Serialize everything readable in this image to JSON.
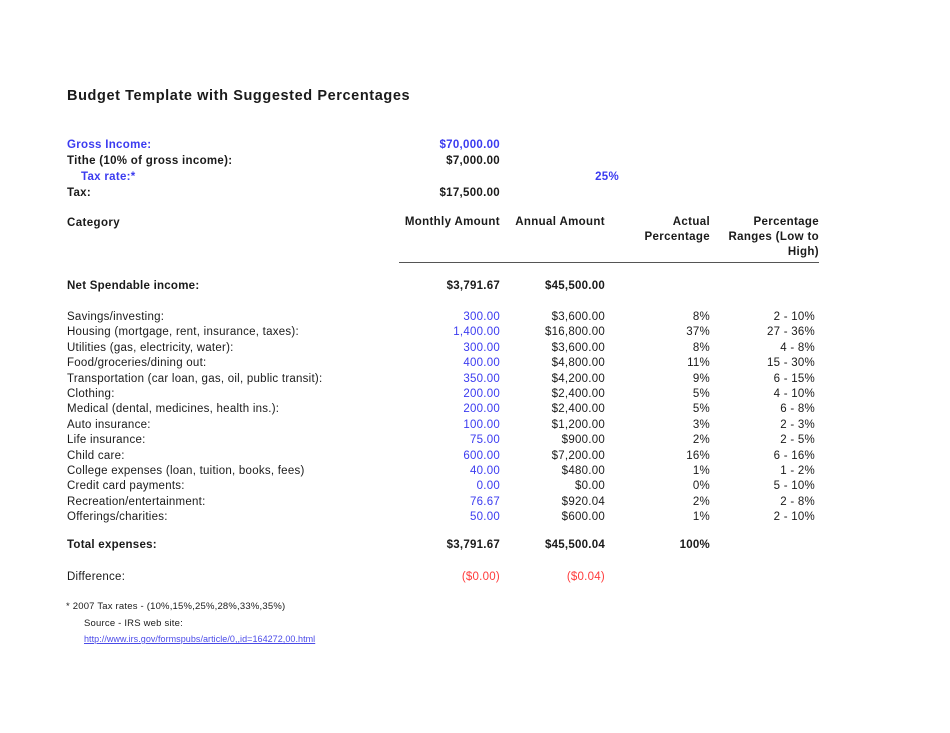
{
  "document": {
    "title": "Budget Template with Suggested Percentages"
  },
  "income": {
    "gross_income_label": "Gross Income:",
    "gross_income_value": "$70,000.00",
    "tithe_label": "Tithe (10% of gross income):",
    "tithe_value": "$7,000.00",
    "tax_rate_label": "Tax rate:*",
    "tax_rate_value": "25%",
    "tax_label": "Tax:",
    "tax_value": "$17,500.00"
  },
  "headers": {
    "category": "Category",
    "monthly_amount": "Monthly Amount",
    "annual_amount": "Annual Amount",
    "actual_percentage": "Actual Percentage",
    "percentage_ranges": "Percentage Ranges (Low to High)"
  },
  "net_spendable": {
    "label": "Net Spendable income:",
    "monthly": "$3,791.67",
    "annual": "$45,500.00"
  },
  "expenses": [
    {
      "label": "Savings/investing:",
      "monthly": "300.00",
      "annual": "$3,600.00",
      "actual": "8%",
      "range": "2 - 10%"
    },
    {
      "label": "Housing (mortgage, rent, insurance, taxes):",
      "monthly": "1,400.00",
      "annual": "$16,800.00",
      "actual": "37%",
      "range": "27 - 36%"
    },
    {
      "label": "Utilities (gas, electricity, water):",
      "monthly": "300.00",
      "annual": "$3,600.00",
      "actual": "8%",
      "range": "4 - 8%"
    },
    {
      "label": "Food/groceries/dining out:",
      "monthly": "400.00",
      "annual": "$4,800.00",
      "actual": "11%",
      "range": "15 - 30%"
    },
    {
      "label": "Transportation (car loan, gas, oil, public transit):",
      "monthly": "350.00",
      "annual": "$4,200.00",
      "actual": "9%",
      "range": "6 - 15%"
    },
    {
      "label": "Clothing:",
      "monthly": "200.00",
      "annual": "$2,400.00",
      "actual": "5%",
      "range": "4 - 10%"
    },
    {
      "label": "Medical (dental, medicines, health ins.):",
      "monthly": "200.00",
      "annual": "$2,400.00",
      "actual": "5%",
      "range": "6 - 8%"
    },
    {
      "label": "Auto insurance:",
      "monthly": "100.00",
      "annual": "$1,200.00",
      "actual": "3%",
      "range": "2 - 3%"
    },
    {
      "label": "Life insurance:",
      "monthly": "75.00",
      "annual": "$900.00",
      "actual": "2%",
      "range": "2 - 5%"
    },
    {
      "label": "Child care:",
      "monthly": "600.00",
      "annual": "$7,200.00",
      "actual": "16%",
      "range": "6 - 16%"
    },
    {
      "label": "College expenses (loan, tuition, books, fees)",
      "monthly": "40.00",
      "annual": "$480.00",
      "actual": "1%",
      "range": "1 - 2%"
    },
    {
      "label": "Credit card payments:",
      "monthly": "0.00",
      "annual": "$0.00",
      "actual": "0%",
      "range": "5 - 10%"
    },
    {
      "label": "Recreation/entertainment:",
      "monthly": "76.67",
      "annual": "$920.04",
      "actual": "2%",
      "range": "2 - 8%"
    },
    {
      "label": "Offerings/charities:",
      "monthly": "50.00",
      "annual": "$600.00",
      "actual": "1%",
      "range": "2 - 10%"
    }
  ],
  "totals": {
    "label": "Total expenses:",
    "monthly": "$3,791.67",
    "annual": "$45,500.04",
    "actual": "100%"
  },
  "difference": {
    "label": "Difference:",
    "monthly": "($0.00)",
    "annual": "($0.04)"
  },
  "footnotes": {
    "tax_rates": "* 2007 Tax rates - (10%,15%,25%,28%,33%,35%)",
    "source": "Source - IRS web site:",
    "url": "http://www.irs.gov/formspubs/article/0,,id=164272,00.html"
  },
  "colors": {
    "input_blue": "#3b3bf0",
    "negative_red": "#ff3b3b",
    "link_blue": "#4a4ae8",
    "text_black": "#1a1a1a"
  }
}
